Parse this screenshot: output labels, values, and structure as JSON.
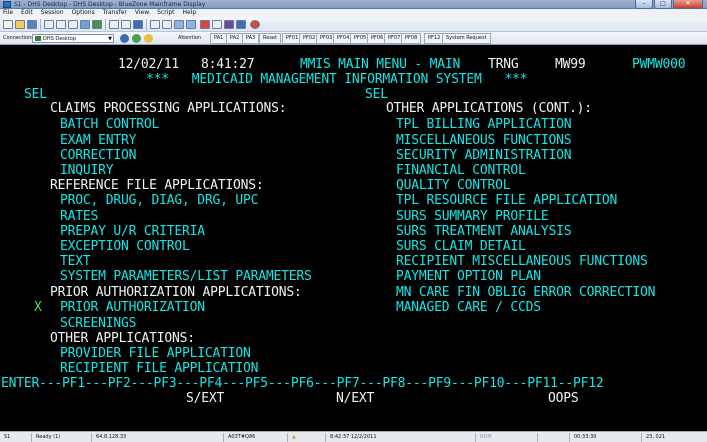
{
  "window": {
    "title": "S1 - DHS Desktop - DHS Desktop - BlueZone Mainframe Display",
    "minimize": "–",
    "maximize": "□",
    "close": "✕"
  },
  "menu": [
    "File",
    "Edit",
    "Session",
    "Options",
    "Transfer",
    "View",
    "Script",
    "Help"
  ],
  "toolbar2": {
    "connections_label": "Connections",
    "session_value": "DHS Desktop",
    "attention": "Attention",
    "buttons": [
      "PA1",
      "PA2",
      "PA3",
      "Reset",
      "PF01",
      "PF02",
      "PF03",
      "PF04",
      "PF05",
      "PF06",
      "PF07",
      "PF08",
      "PF12",
      "System Request"
    ]
  },
  "screen": {
    "header": {
      "date": "12/02/11",
      "time": "8:41:27",
      "menu_title": "MMIS MAIN MENU - MAIN",
      "region": "TRNG",
      "terminal_id": "MW99",
      "screen_id": "PWMW000"
    },
    "system_title": "***   MEDICAID MANAGEMENT INFORMATION SYSTEM   ***",
    "sel_left": "SEL",
    "sel_right": "SEL",
    "left": {
      "claims_heading": "CLAIMS PROCESSING APPLICATIONS:",
      "claims_items": [
        "BATCH CONTROL",
        "EXAM ENTRY",
        "CORRECTION",
        "INQUIRY"
      ],
      "reference_heading": "REFERENCE FILE APPLICATIONS:",
      "reference_items": [
        "PROC, DRUG, DIAG, DRG, UPC",
        "RATES",
        "PREPAY U/R CRITERIA",
        "EXCEPTION CONTROL",
        "TEXT",
        "SYSTEM PARAMETERS/LIST PARAMETERS"
      ],
      "prior_heading": "PRIOR AUTHORIZATION APPLICATIONS:",
      "selection_mark": "X",
      "prior_items": [
        "PRIOR AUTHORIZATION",
        "SCREENINGS"
      ],
      "other_heading": "OTHER APPLICATIONS:",
      "other_items": [
        "PROVIDER FILE APPLICATION",
        "RECIPIENT FILE APPLICATION"
      ]
    },
    "right": {
      "heading": "OTHER APPLICATIONS (CONT.):",
      "items": [
        "TPL BILLING APPLICATION",
        "MISCELLANEOUS FUNCTIONS",
        "SECURITY ADMINISTRATION",
        "FINANCIAL CONTROL",
        "QUALITY CONTROL",
        "TPL RESOURCE FILE APPLICATION",
        "SURS SUMMARY PROFILE",
        "SURS TREATMENT ANALYSIS",
        "SURS CLAIM DETAIL",
        "RECIPIENT MISCELLANEOUS FUNCTIONS",
        "PAYMENT OPTION PLAN",
        "MN CARE FIN OBLIG ERROR CORRECTION",
        "MANAGED CARE / CCDS"
      ]
    },
    "pf_line": "ENTER---PF1---PF2---PF3---PF4---PF5---PF6---PF7---PF8---PF9---PF10---PF11--PF12",
    "pf_labels": {
      "pf3": "S/EXT",
      "pf6": "N/EXT",
      "pf10": "OOPS"
    }
  },
  "status": {
    "session": "S1",
    "state": "Ready (1)",
    "host": "64.8.128.33",
    "lu": "A03T#Q86",
    "lock_icon": "lock-icon",
    "timestamp": "8:42:37  12/2/2011",
    "num": "NUM",
    "elapsed": "00:33:30",
    "cursor": "23, 021"
  },
  "colors": {
    "terminal_bg": "#000000",
    "text_white": "#f2f2f2",
    "text_cyan": "#14e6e6",
    "text_green": "#37e84a",
    "text_blue": "#3a8cff"
  }
}
